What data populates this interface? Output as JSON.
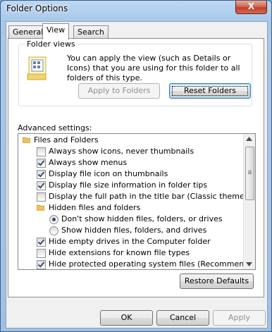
{
  "window": {
    "title": "Folder Options",
    "close_glyph": "X"
  },
  "tabs": [
    {
      "label": "General"
    },
    {
      "label": "View"
    },
    {
      "label": "Search"
    }
  ],
  "folder_views": {
    "group_label": "Folder views",
    "description": "You can apply the view (such as Details or Icons) that you are using for this folder to all folders of this type.",
    "apply_button": "Apply to Folders",
    "reset_button": "Reset Folders"
  },
  "advanced": {
    "label": "Advanced settings:",
    "items": [
      {
        "kind": "folder",
        "text": "Files and Folders"
      },
      {
        "kind": "checkbox",
        "checked": false,
        "text": "Always show icons, never thumbnails"
      },
      {
        "kind": "checkbox",
        "checked": true,
        "text": "Always show menus"
      },
      {
        "kind": "checkbox",
        "checked": true,
        "text": "Display file icon on thumbnails"
      },
      {
        "kind": "checkbox",
        "checked": true,
        "text": "Display file size information in folder tips"
      },
      {
        "kind": "checkbox",
        "checked": false,
        "text": "Display the full path in the title bar (Classic theme only)"
      },
      {
        "kind": "folder",
        "text": "Hidden files and folders"
      },
      {
        "kind": "radio",
        "checked": true,
        "text": "Don't show hidden files, folders, or drives"
      },
      {
        "kind": "radio",
        "checked": false,
        "text": "Show hidden files, folders, and drives"
      },
      {
        "kind": "checkbox",
        "checked": true,
        "text": "Hide empty drives in the Computer folder"
      },
      {
        "kind": "checkbox",
        "checked": false,
        "text": "Hide extensions for known file types"
      },
      {
        "kind": "checkbox",
        "checked": true,
        "text": "Hide protected operating system files (Recommended)"
      }
    ]
  },
  "restore_button": "Restore Defaults",
  "buttons": {
    "ok": "OK",
    "cancel": "Cancel",
    "apply": "Apply"
  },
  "colors": {
    "title_bar": "#a8c8ea",
    "close_red": "#c1402a",
    "focus_blue": "#3c7fb1"
  }
}
